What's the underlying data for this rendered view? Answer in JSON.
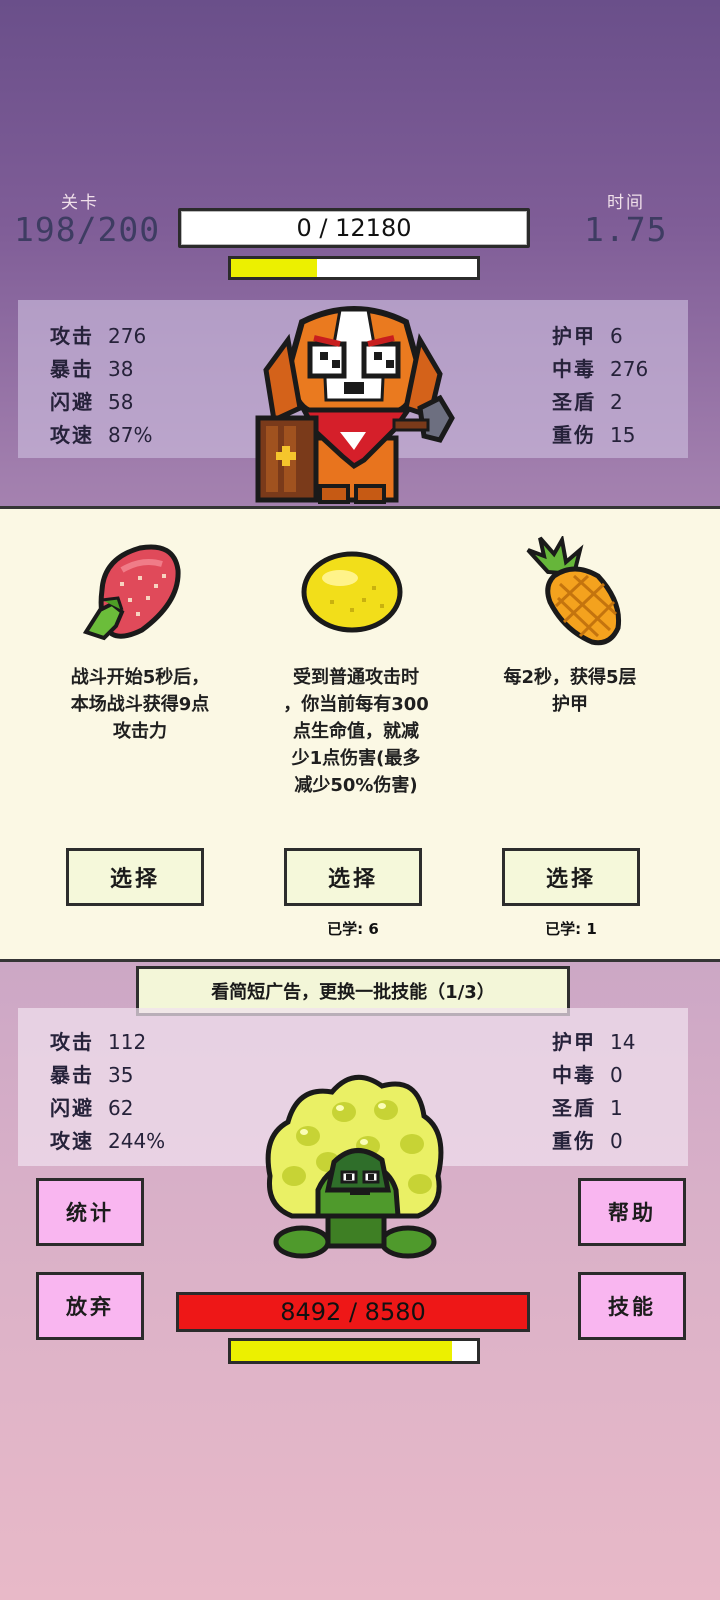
{
  "header": {
    "level_label": "关卡",
    "level_value": "198/200",
    "time_label": "时间",
    "time_value": "1.75",
    "damage_display": "0 / 12180",
    "progress_fraction": 0.35
  },
  "player": {
    "left_stats": [
      {
        "key": "攻击",
        "value": "276"
      },
      {
        "key": "暴击",
        "value": "38"
      },
      {
        "key": "闪避",
        "value": "58"
      },
      {
        "key": "攻速",
        "value": "87%"
      }
    ],
    "right_stats": [
      {
        "key": "护甲",
        "value": "6"
      },
      {
        "key": "中毒",
        "value": "276"
      },
      {
        "key": "圣盾",
        "value": "2"
      },
      {
        "key": "重伤",
        "value": "15"
      }
    ],
    "sprite": "dog-warrior-sprite"
  },
  "skills": [
    {
      "icon": "strawberry-icon",
      "desc": [
        "战斗开始5秒后，",
        "本场战斗获得9点",
        "攻击力"
      ],
      "button": "选择",
      "learned": ""
    },
    {
      "icon": "lemon-icon",
      "desc": [
        "受到普通攻击时",
        "，你当前每有300",
        "点生命值，就减",
        "少1点伤害(最多",
        "减少50%伤害)"
      ],
      "button": "选择",
      "learned": "已学: 6"
    },
    {
      "icon": "pineapple-icon",
      "desc": [
        "每2秒，获得5层",
        "护甲"
      ],
      "button": "选择",
      "learned": "已学: 1"
    }
  ],
  "ad_banner": "看简短广告，更换一批技能（1/3）",
  "enemy": {
    "left_stats": [
      {
        "key": "攻击",
        "value": "112"
      },
      {
        "key": "暴击",
        "value": "35"
      },
      {
        "key": "闪避",
        "value": "62"
      },
      {
        "key": "攻速",
        "value": "244%"
      }
    ],
    "right_stats": [
      {
        "key": "护甲",
        "value": "14"
      },
      {
        "key": "中毒",
        "value": "0"
      },
      {
        "key": "圣盾",
        "value": "1"
      },
      {
        "key": "重伤",
        "value": "0"
      }
    ],
    "sprite": "turtle-enemy-sprite",
    "hp_display": "8492 / 8580",
    "hp_fraction": 0.99,
    "charge_fraction": 0.9
  },
  "buttons": {
    "stats": "统计",
    "give_up": "放弃",
    "help": "帮助",
    "skills": "技能"
  },
  "colors": {
    "hp_bar": "#ee1717",
    "charge_bar": "#ecf000",
    "side_button": "#f9b6f0",
    "card_panel": "#fbf8e4"
  }
}
